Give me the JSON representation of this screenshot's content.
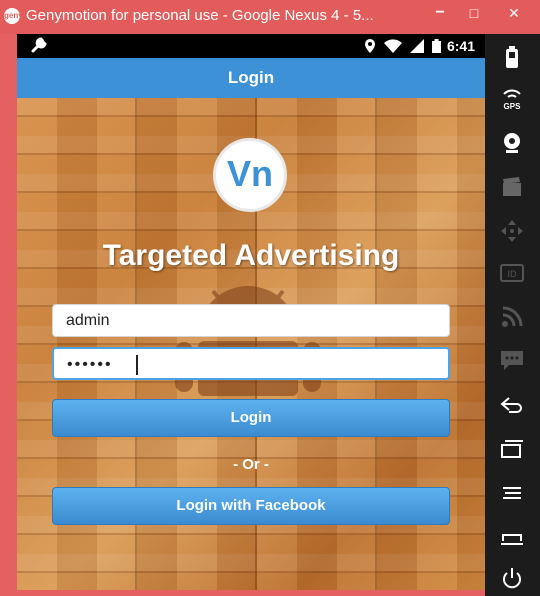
{
  "window": {
    "title": "Genymotion for personal use - Google Nexus 4 - 5...",
    "app_logo_text": "geny",
    "minimize_label": "−",
    "maximize_label": "□",
    "close_label": "✕"
  },
  "status_bar": {
    "time": "6:41",
    "icons": [
      "wrench-icon",
      "location-icon",
      "wifi-icon",
      "signal-icon",
      "battery-icon"
    ]
  },
  "action_bar": {
    "title": "Login"
  },
  "app": {
    "logo_text": "Vn",
    "title": "Targeted Advertising"
  },
  "form": {
    "username_value": "admin",
    "password_value": "••••••",
    "login_label": "Login",
    "or_label": "- Or -",
    "facebook_label": "Login with Facebook"
  },
  "sidebar": {
    "tools": [
      "battery-icon",
      "gps-icon",
      "webcam-icon",
      "capture-icon",
      "move-icon",
      "id-icon",
      "rss-icon",
      "sms-icon",
      "back-icon",
      "recent-apps-icon",
      "menu-icon",
      "home-icon",
      "power-icon"
    ],
    "gps_label": "GPS",
    "id_label": "ID"
  },
  "colors": {
    "accent": "#3d91d6",
    "title_bar": "#e35c5c",
    "sidebar": "#1c1c1c"
  }
}
